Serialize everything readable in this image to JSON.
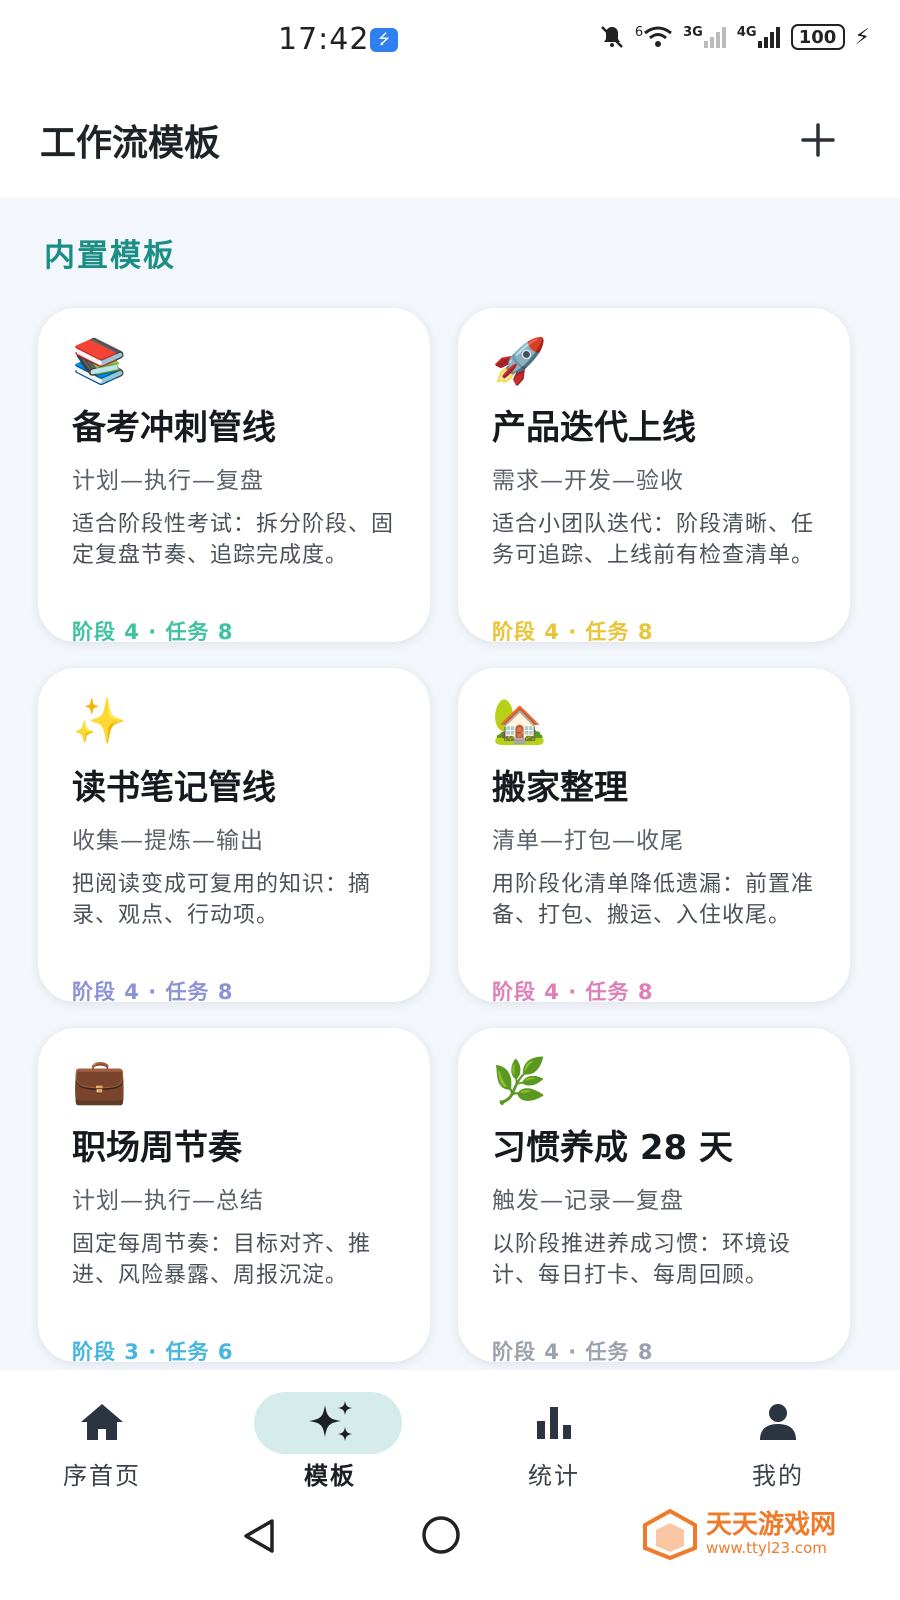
{
  "status_bar": {
    "time": "17:42",
    "usb_glyph": "⭍",
    "wifi_badge": "6",
    "signal_3g": "3G",
    "signal_4g": "4G",
    "battery": "100"
  },
  "header": {
    "title": "工作流模板",
    "add_label": "+"
  },
  "section": {
    "title": "内置模板"
  },
  "templates": [
    {
      "emoji": "📚",
      "title": "备考冲刺管线",
      "flow": "计划—执行—复盘",
      "description": "适合阶段性考试：拆分阶段、固定复盘节奏、追踪完成度。",
      "meta": "阶段 4 · 任务 8",
      "accent": "#3ec2a0"
    },
    {
      "emoji": "🚀",
      "title": "产品迭代上线",
      "flow": "需求—开发—验收",
      "description": "适合小团队迭代：阶段清晰、任务可追踪、上线前有检查清单。",
      "meta": "阶段 4 · 任务 8",
      "accent": "#e9c338"
    },
    {
      "emoji": "✨",
      "title": "读书笔记管线",
      "flow": "收集—提炼—输出",
      "description": "把阅读变成可复用的知识：摘录、观点、行动项。",
      "meta": "阶段 4 · 任务 8",
      "accent": "#8b93d6"
    },
    {
      "emoji": "🏡",
      "title": "搬家整理",
      "flow": "清单—打包—收尾",
      "description": "用阶段化清单降低遗漏：前置准备、打包、搬运、入住收尾。",
      "meta": "阶段 4 · 任务 8",
      "accent": "#e07fb7"
    },
    {
      "emoji": "💼",
      "title": "职场周节奏",
      "flow": "计划—执行—总结",
      "description": "固定每周节奏：目标对齐、推进、风险暴露、周报沉淀。",
      "meta": "阶段 3 · 任务 6",
      "accent": "#45b6df"
    },
    {
      "emoji": "🌿",
      "title": "习惯养成 28 天",
      "flow": "触发—记录—复盘",
      "description": "以阶段推进养成习惯：环境设计、每日打卡、每周回顾。",
      "meta": "阶段 4 · 任务 8",
      "accent": "#9aa2ad"
    }
  ],
  "bottom_nav": {
    "items": [
      {
        "label": "序首页",
        "icon": "home-icon",
        "active": false
      },
      {
        "label": "模板",
        "icon": "sparkles-icon",
        "active": true
      },
      {
        "label": "统计",
        "icon": "bar-chart-icon",
        "active": false
      },
      {
        "label": "我的",
        "icon": "person-icon",
        "active": false
      }
    ]
  },
  "watermark": {
    "name": "天天游戏网",
    "url": "www.ttyl23.com"
  }
}
